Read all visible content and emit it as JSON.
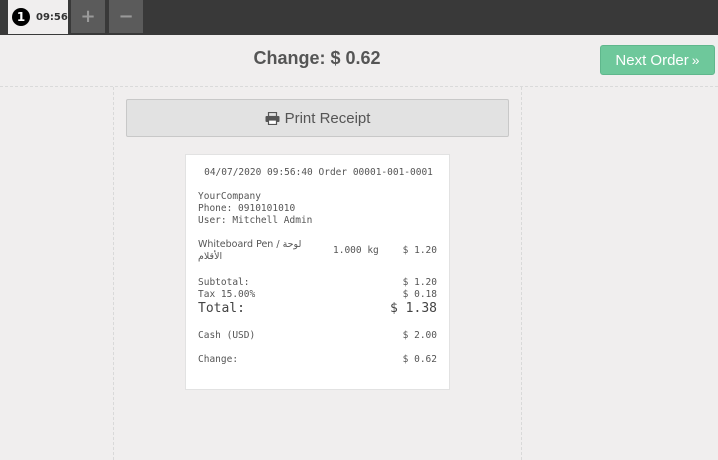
{
  "tabs": {
    "order_number": "1",
    "order_time": "09:56",
    "add_label": "+",
    "remove_label": "−"
  },
  "header": {
    "change_title": "Change: $ 0.62",
    "next_order_label": "Next Order",
    "next_order_icon": "double-chevron-right-icon"
  },
  "actions": {
    "print_label": "Print Receipt",
    "print_icon": "printer-icon"
  },
  "receipt": {
    "header_line": "04/07/2020 09:56:40 Order 00001-001-0001",
    "company": "YourCompany",
    "phone": "Phone: 0910101010",
    "user": "User: Mitchell Admin",
    "item": {
      "name_line1": "Whiteboard Pen / لوحة",
      "name_line2": "الأقلام",
      "quantity": "1.000 kg",
      "price": "$ 1.20"
    },
    "subtotal_label": "Subtotal:",
    "subtotal_value": "$ 1.20",
    "tax_label": "Tax 15.00%",
    "tax_value": "$ 0.18",
    "total_label": "Total:",
    "total_value": "$ 1.38",
    "payment_label": "Cash (USD)",
    "payment_value": "$ 2.00",
    "change_label": "Change:",
    "change_value": "$ 0.62"
  },
  "colors": {
    "topbar": "#393939",
    "accent_green": "#6ec89b",
    "background": "#f0eeee"
  }
}
